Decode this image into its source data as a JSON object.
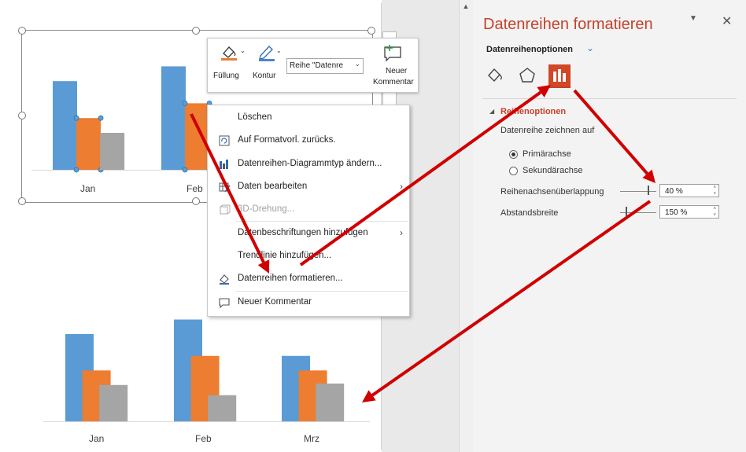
{
  "colors": {
    "accent": "#c4422b",
    "series_blue": "#5b9bd5",
    "series_orange": "#ed7d31",
    "series_gray": "#a5a5a5",
    "arrow_red": "#d10000"
  },
  "top_chart": {
    "categories": [
      "Jan",
      "Feb"
    ]
  },
  "bottom_chart": {
    "categories": [
      "Jan",
      "Feb",
      "Mrz"
    ]
  },
  "chart_data": {
    "type": "bar",
    "categories": [
      "Jan",
      "Feb",
      "Mrz"
    ],
    "series": [
      {
        "values": [
          6,
          7,
          4.5
        ]
      },
      {
        "values": [
          3.5,
          4.5,
          3.5
        ]
      },
      {
        "values": [
          2.5,
          1.8,
          2.6
        ]
      }
    ],
    "overlap_percent": 40,
    "gap_width_percent": 150,
    "grid": false
  },
  "mini_toolbar": {
    "fill_label": "Füllung",
    "outline_label": "Kontur",
    "series_select": "Reihe \"Datenre",
    "comment_label_1": "Neuer",
    "comment_label_2": "Kommentar"
  },
  "context_menu": {
    "items": [
      {
        "label": "Löschen"
      },
      {
        "label": "Auf Formatvorl. zurücks."
      },
      {
        "label": "Datenreihen-Diagrammtyp ändern..."
      },
      {
        "label": "Daten bearbeiten"
      },
      {
        "label": "3D-Drehung..."
      },
      {
        "label": "Datenbeschriftungen hinzufügen"
      },
      {
        "label": "Trendlinie hinzufügen..."
      },
      {
        "label": "Datenreihen formatieren..."
      },
      {
        "label": "Neuer Kommentar"
      }
    ]
  },
  "pane": {
    "title": "Datenreihen formatieren",
    "options_title": "Datenreihenoptionen",
    "section_title": "Reihenoptionen",
    "plot_on_label": "Datenreihe zeichnen auf",
    "primary_axis": "Primärachse",
    "secondary_axis": "Sekundärachse",
    "overlap_label": "Reihenachsenüberlappung",
    "overlap_value": "40 %",
    "gap_label": "Abstandsbreite",
    "gap_value": "150 %"
  }
}
